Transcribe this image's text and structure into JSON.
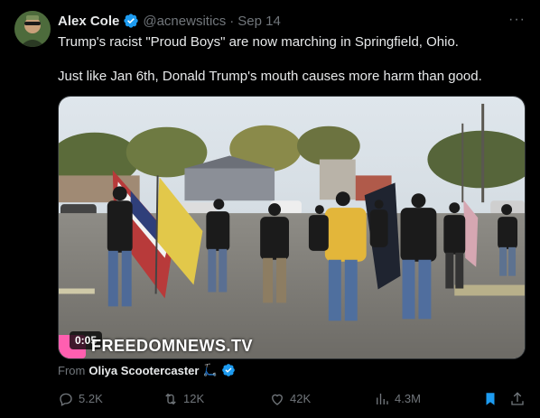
{
  "tweet": {
    "author_name": "Alex Cole",
    "author_handle": "@acnewsitics",
    "separator": "·",
    "date": "Sep 14",
    "more_label": "···",
    "text_line1": "Trump's racist \"Proud Boys\" are now marching in Springfield, Ohio.",
    "text_line2": "Just like Jan 6th, Donald Trump's mouth causes more harm than good."
  },
  "media": {
    "duration": "0:05",
    "watermark": "FREEDOMNEWS.TV"
  },
  "source": {
    "prefix": "From",
    "name": "Oliya Scootercaster",
    "emoji": "🛴"
  },
  "actions": {
    "replies": "5.2K",
    "retweets": "12K",
    "likes": "42K",
    "views": "4.3M"
  },
  "colors": {
    "background": "#000000",
    "text": "#e7e9ea",
    "muted": "#71767b",
    "verified": "#1d9bf0",
    "bookmark": "#1d9bf0"
  }
}
